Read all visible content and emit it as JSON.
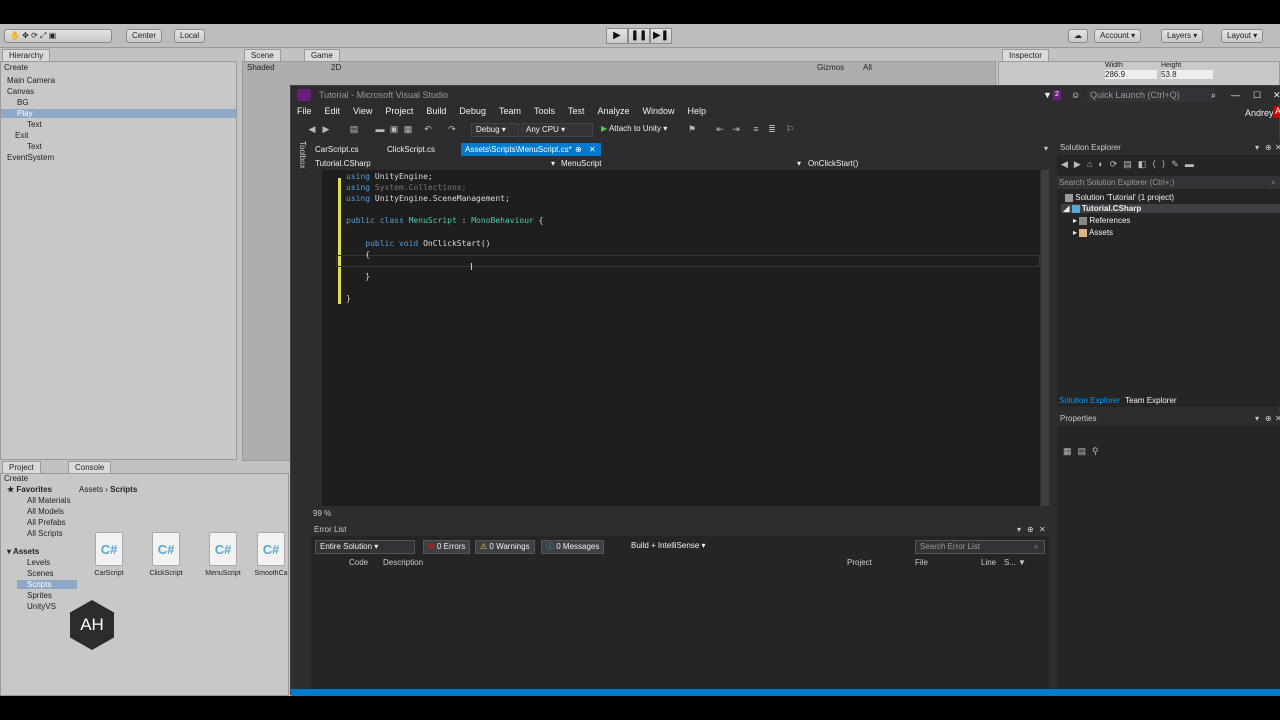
{
  "unity": {
    "toolbar": {
      "center": "Center",
      "local": "Local",
      "play_icon": "play-icon",
      "pause_icon": "pause-icon",
      "step_icon": "step-icon",
      "account": "Account",
      "layers": "Layers",
      "layout": "Layout"
    },
    "hierarchy": {
      "tab": "Hierarchy",
      "create": "Create",
      "items": [
        "Main Camera",
        "Canvas",
        "BG",
        "Play",
        "Text",
        "Exit",
        "Text",
        "EventSystem"
      ]
    },
    "scene": {
      "tab_scene": "Scene",
      "tab_game": "Game",
      "shaded": "Shaded",
      "mode_2d": "2D",
      "gizmos": "Gizmos",
      "search": "All"
    },
    "inspector": {
      "tab": "Inspector",
      "width_label": "Width",
      "height_label": "Height",
      "width": "286.9",
      "height": "53.8"
    },
    "project": {
      "tab_project": "Project",
      "tab_console": "Console",
      "create": "Create",
      "favorites": "Favorites",
      "fav_items": [
        "All Materials",
        "All Models",
        "All Prefabs",
        "All Scripts"
      ],
      "assets": "Assets",
      "asset_items": [
        "Levels",
        "Scenes",
        "Scripts",
        "Sprites",
        "UnityVS"
      ],
      "breadcrumb_root": "Assets",
      "breadcrumb_sep": "›",
      "breadcrumb_current": "Scripts",
      "files": [
        "CarScript",
        "ClickScript",
        "MenuScript",
        "SmoothCa"
      ]
    }
  },
  "vs": {
    "title": "Tutorial - Microsoft Visual Studio",
    "notif_count": "2",
    "quick_launch": "Quick Launch (Ctrl+Q)",
    "user": "Andrey",
    "menu": [
      "File",
      "Edit",
      "View",
      "Project",
      "Build",
      "Debug",
      "Team",
      "Tools",
      "Test",
      "Analyze",
      "Window",
      "Help"
    ],
    "toolbar": {
      "config": "Debug",
      "platform": "Any CPU",
      "attach": "Attach to Unity"
    },
    "toolbox": "Toolbox",
    "tabs": [
      "CarScript.cs",
      "ClickScript.cs",
      "Assets\\Scripts\\MenuScript.cs*"
    ],
    "nav": {
      "project": "Tutorial.CSharp",
      "class": "MenuScript",
      "member": "OnClickStart()"
    },
    "code": [
      {
        "kw": "using",
        "rest": " UnityEngine;"
      },
      {
        "kw": "using",
        "rest": " System.Collections;"
      },
      {
        "kw": "using",
        "rest": " UnityEngine.SceneManagement;"
      },
      {
        "kw": "",
        "rest": ""
      },
      {
        "kw": "public class",
        "cls": " MenuScript",
        "rest": " : ",
        "base": "MonoBehaviour",
        "tail": " {"
      },
      {
        "kw": "",
        "rest": ""
      },
      {
        "kw": "    public void",
        "rest": " OnClickStart()"
      },
      {
        "kw": "",
        "rest": "    {"
      },
      {
        "kw": "",
        "rest": ""
      },
      {
        "kw": "",
        "rest": "    }"
      },
      {
        "kw": "",
        "rest": ""
      },
      {
        "kw": "",
        "rest": "}"
      }
    ],
    "zoom": "99 %",
    "error_list": {
      "title": "Error List",
      "scope": "Entire Solution",
      "errors": "0 Errors",
      "warnings": "0 Warnings",
      "messages": "0 Messages",
      "build": "Build + IntelliSense",
      "search": "Search Error List",
      "columns": [
        "Code",
        "Description",
        "Project",
        "File",
        "Line",
        "S..."
      ]
    },
    "solution_explorer": {
      "title": "Solution Explorer",
      "search": "Search Solution Explorer (Ctrl+;)",
      "solution": "Solution 'Tutorial' (1 project)",
      "project": "Tutorial.CSharp",
      "references": "References",
      "assets": "Assets",
      "tab_solution": "Solution Explorer",
      "tab_team": "Team Explorer"
    },
    "properties": {
      "title": "Properties"
    }
  },
  "avatar": "AH",
  "colors": {
    "vs_accent": "#007acc",
    "vs_bg": "#2d2d30",
    "editor_bg": "#1e1e1e",
    "keyword": "#569cd6",
    "type": "#4ec9b0"
  }
}
